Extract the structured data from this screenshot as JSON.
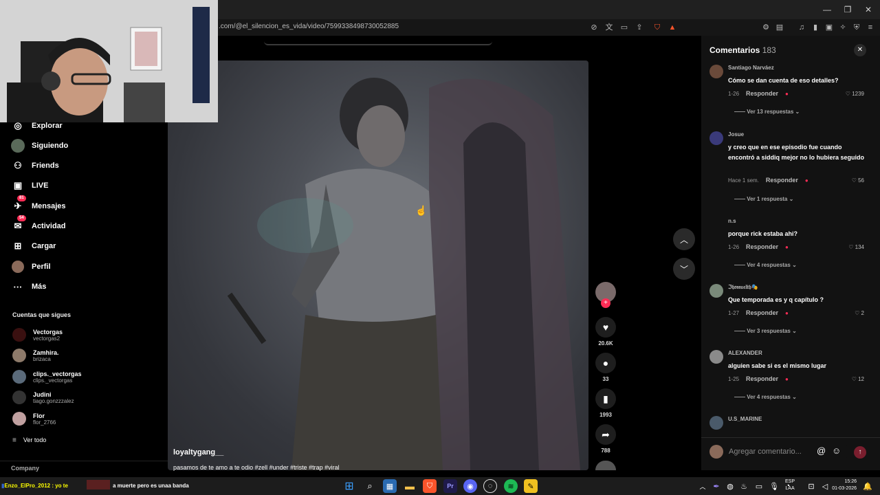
{
  "browser": {
    "url": ".com/@el_silencion_es_vida/video/7599338498730052885",
    "window_controls": [
      "—",
      "❐",
      "✕"
    ]
  },
  "sidebar": {
    "items": [
      {
        "label": "Explorar",
        "icon": "compass-icon",
        "glyph": "◎"
      },
      {
        "label": "Siguiendo",
        "icon": "avatar-icon",
        "glyph": ""
      },
      {
        "label": "Friends",
        "icon": "friends-icon",
        "glyph": "👥"
      },
      {
        "label": "LIVE",
        "icon": "live-icon",
        "glyph": "▣"
      },
      {
        "label": "Mensajes",
        "icon": "messages-icon",
        "glyph": "✈",
        "badge": "81"
      },
      {
        "label": "Actividad",
        "icon": "activity-icon",
        "glyph": "✉",
        "badge": "54"
      },
      {
        "label": "Cargar",
        "icon": "upload-icon",
        "glyph": "⊞"
      },
      {
        "label": "Perfil",
        "icon": "profile-icon",
        "glyph": ""
      },
      {
        "label": "Más",
        "icon": "more-icon",
        "glyph": "···"
      }
    ],
    "following_title": "Cuentas que sigues",
    "accounts": [
      {
        "name": "Vectorgas",
        "handle": "vectorgas2"
      },
      {
        "name": "Zamhira.",
        "handle": "brizaca"
      },
      {
        "name": "clips._vectorgas",
        "handle": "clips._vectorgas"
      },
      {
        "name": "Judini",
        "handle": "tiago.gonzzzalez"
      },
      {
        "name": "Flor",
        "handle": "flor_2766"
      }
    ],
    "see_all": "Ver todo",
    "company": "Company"
  },
  "video": {
    "username": "loyaltygang__",
    "caption": "pasamos de te amo a te odio #zell #under #triste #trap #viral",
    "likes": "20.6K",
    "comments": "33",
    "saves": "1993",
    "shares": "788"
  },
  "comments_panel": {
    "title": "Comentarios",
    "count": "183",
    "input_placeholder": "Agregar comentario...",
    "items": [
      {
        "user": "Santiago Narváez",
        "text": "Cómo se dan cuenta de eso detalles?",
        "date": "1-26",
        "reply": "Responder",
        "likes": "1239",
        "more": "Ver 13 respuestas"
      },
      {
        "user": "Josue",
        "text": "y creo que en ese episodio fue cuando encontró a siddiq mejor no lo hubiera seguido",
        "date": "Hace 1 sem.",
        "reply": "Responder",
        "likes": "56",
        "more": "Ver 1 respuesta"
      },
      {
        "user": "n.s",
        "text": "porque rick estaba ahi?",
        "date": "1-26",
        "reply": "Responder",
        "likes": "134",
        "more": "Ver 4 respuestas"
      },
      {
        "user": "ℑ𝔥𝔬𝔰𝔰𝔲𝔢𝔩𝔱𝔥🎭",
        "text": "Que temporada es y q capítulo ?",
        "date": "1-27",
        "reply": "Responder",
        "likes": "2",
        "more": "Ver 3 respuestas"
      },
      {
        "user": "ALEXANDER",
        "text": "alguien sabe si es el mismo lugar",
        "date": "1-25",
        "reply": "Responder",
        "likes": "12",
        "more": "Ver 4 respuestas"
      },
      {
        "user": "U.S_MARINE",
        "text": "",
        "date": "",
        "reply": "",
        "likes": "",
        "more": ""
      }
    ]
  },
  "taskbar": {
    "notification": "Enzo_ElPro_2012 : yo te",
    "notification2": "a muerte pero es unaa banda",
    "lang": "ESP",
    "lang2": "LAA",
    "time": "15:26",
    "date": "01-03-2026"
  },
  "colors": {
    "accent": "#fe2c55",
    "panel": "#121212",
    "background": "#000000"
  }
}
